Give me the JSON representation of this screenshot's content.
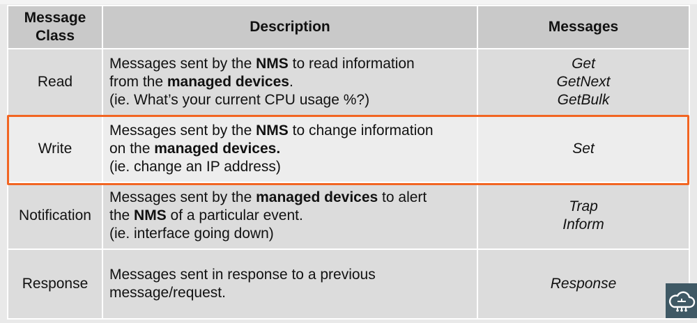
{
  "table": {
    "headers": {
      "class_line1": "Message",
      "class_line2": "Class",
      "description": "Description",
      "messages": "Messages"
    },
    "rows": [
      {
        "class": "Read",
        "desc": {
          "l1a": "Messages sent by the ",
          "l1b": "NMS",
          "l1c": " to read information",
          "l2a": "from the ",
          "l2b": "managed devices",
          "l2c": ".",
          "l3": "(ie. What’s your current CPU usage %?)"
        },
        "messages": [
          "Get",
          "GetNext",
          "GetBulk"
        ]
      },
      {
        "class": "Write",
        "desc": {
          "l1a": "Messages sent by the ",
          "l1b": "NMS",
          "l1c": " to change information",
          "l2a": "on the ",
          "l2b": "managed devices.",
          "l3": "(ie. change an IP address)"
        },
        "messages": [
          "Set"
        ]
      },
      {
        "class": "Notification",
        "desc": {
          "l1a": "Messages sent by the ",
          "l1b": "managed devices",
          "l1c": " to alert",
          "l2a": "the ",
          "l2b": "NMS",
          "l2c": " of a particular event.",
          "l3": "(ie. interface going down)"
        },
        "messages": [
          "Trap",
          "Inform"
        ]
      },
      {
        "class": "Response",
        "desc": {
          "l1": "Messages sent in response to a previous",
          "l2": "message/request."
        },
        "messages": [
          "Response"
        ]
      }
    ]
  },
  "highlight_color": "#f26522",
  "logo": {
    "icon": "cloud-circuit-icon",
    "bg": "#3f5965"
  }
}
